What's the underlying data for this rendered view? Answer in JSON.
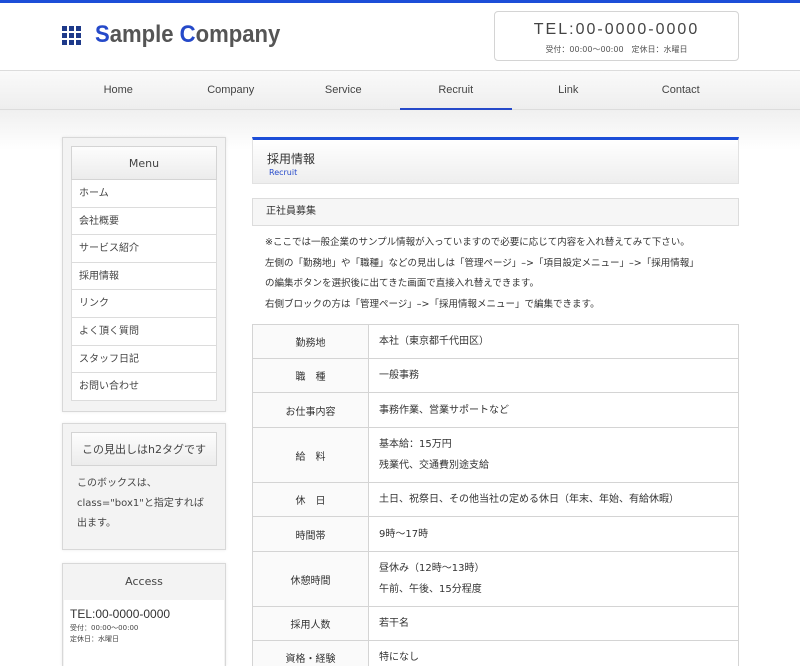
{
  "colors": {
    "accent": "#1d4ed8",
    "brand_blue": "#2549c9",
    "text": "#333333"
  },
  "header": {
    "logo_icon": "grid-icon",
    "brand_parts": [
      {
        "text": "S",
        "color": "blue"
      },
      {
        "text": "ample ",
        "color": "gray"
      },
      {
        "text": "C",
        "color": "blue"
      },
      {
        "text": "ompany",
        "color": "gray"
      }
    ],
    "tel": "TEL:00-0000-0000",
    "hours": "受付：00:00〜00:00　定休日：水曜日"
  },
  "nav": {
    "items": [
      {
        "label": "Home"
      },
      {
        "label": "Company"
      },
      {
        "label": "Service"
      },
      {
        "label": "Recruit",
        "active": true
      },
      {
        "label": "Link"
      },
      {
        "label": "Contact"
      }
    ]
  },
  "sidebar": {
    "menu_title": "Menu",
    "menu_items": [
      {
        "label": "ホーム"
      },
      {
        "label": "会社概要"
      },
      {
        "label": "サービス紹介"
      },
      {
        "label": "採用情報"
      },
      {
        "label": "リンク"
      },
      {
        "label": "よく頂く質問"
      },
      {
        "label": "スタッフ日記"
      },
      {
        "label": "お問い合わせ"
      }
    ],
    "h2box": {
      "title": "この見出しはh2タグです",
      "line1": "このボックスは、",
      "line2": "class=\"box1\"と指定すれば",
      "line3": "出ます。"
    },
    "access": {
      "title": "Access",
      "tel": "TEL:00-0000-0000",
      "hours": "受付：00:00〜00:00",
      "holiday": "定休日：水曜日"
    }
  },
  "main": {
    "title": "採用情報",
    "subtitle": "Recruit",
    "section": "正社員募集",
    "intro": [
      "※ここでは一般企業のサンプル情報が入っていますので必要に応じて内容を入れ替えてみて下さい。",
      "左側の「勤務地」や「職種」などの見出しは「管理ページ」–>「項目設定メニュー」–>「採用情報」",
      "の編集ボタンを選択後に出てきた画面で直接入れ替えできます。",
      "右側ブロックの方は「管理ページ」–>「採用情報メニュー」で編集できます。"
    ],
    "rows": [
      {
        "key": "勤務地",
        "lines": [
          "本社（東京都千代田区）"
        ]
      },
      {
        "key": "職　種",
        "lines": [
          "一般事務"
        ]
      },
      {
        "key": "お仕事内容",
        "lines": [
          "事務作業、営業サポートなど"
        ]
      },
      {
        "key": "給　料",
        "lines": [
          "基本給：15万円",
          "残業代、交通費別途支給"
        ]
      },
      {
        "key": "休　日",
        "lines": [
          "土日、祝祭日、その他当社の定める休日（年末、年始、有給休暇）"
        ]
      },
      {
        "key": "時間帯",
        "lines": [
          "9時〜17時"
        ]
      },
      {
        "key": "休憩時間",
        "lines": [
          "昼休み（12時〜13時）",
          "午前、午後、15分程度"
        ]
      },
      {
        "key": "採用人数",
        "lines": [
          "若干名"
        ]
      },
      {
        "key": "資格・経験",
        "lines": [
          "特になし"
        ]
      }
    ]
  }
}
